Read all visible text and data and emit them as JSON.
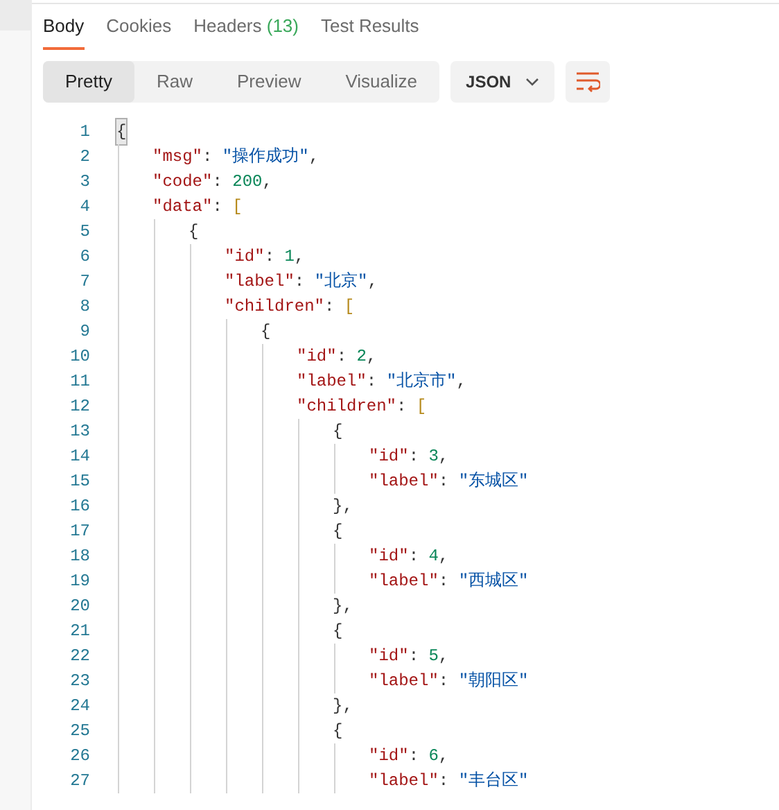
{
  "tabs": [
    {
      "label": "Body",
      "selected": true
    },
    {
      "label": "Cookies",
      "selected": false
    },
    {
      "label": "Headers",
      "count": "(13)",
      "selected": false
    },
    {
      "label": "Test Results",
      "selected": false
    }
  ],
  "view_modes": [
    {
      "label": "Pretty",
      "selected": true
    },
    {
      "label": "Raw",
      "selected": false
    },
    {
      "label": "Preview",
      "selected": false
    },
    {
      "label": "Visualize",
      "selected": false
    }
  ],
  "format_dropdown": {
    "value": "JSON"
  },
  "code": [
    {
      "number": "1",
      "tokens": [
        {
          "kind": "matched-brace",
          "text": "{"
        }
      ],
      "children": [
        {
          "number": "2",
          "tokens": [
            {
              "kind": "key",
              "text": "\"msg\""
            },
            {
              "kind": "punct",
              "text": ": "
            },
            {
              "kind": "string",
              "text": "\"操作成功\""
            },
            {
              "kind": "punct",
              "text": ","
            }
          ]
        },
        {
          "number": "3",
          "tokens": [
            {
              "kind": "key",
              "text": "\"code\""
            },
            {
              "kind": "punct",
              "text": ": "
            },
            {
              "kind": "number",
              "text": "200"
            },
            {
              "kind": "punct",
              "text": ","
            }
          ]
        },
        {
          "number": "4",
          "tokens": [
            {
              "kind": "key",
              "text": "\"data\""
            },
            {
              "kind": "punct",
              "text": ": "
            },
            {
              "kind": "bracket",
              "text": "["
            }
          ],
          "children": [
            {
              "number": "5",
              "tokens": [
                {
                  "kind": "punct",
                  "text": "{"
                }
              ],
              "children": [
                {
                  "number": "6",
                  "tokens": [
                    {
                      "kind": "key",
                      "text": "\"id\""
                    },
                    {
                      "kind": "punct",
                      "text": ": "
                    },
                    {
                      "kind": "number",
                      "text": "1"
                    },
                    {
                      "kind": "punct",
                      "text": ","
                    }
                  ]
                },
                {
                  "number": "7",
                  "tokens": [
                    {
                      "kind": "key",
                      "text": "\"label\""
                    },
                    {
                      "kind": "punct",
                      "text": ": "
                    },
                    {
                      "kind": "string",
                      "text": "\"北京\""
                    },
                    {
                      "kind": "punct",
                      "text": ","
                    }
                  ]
                },
                {
                  "number": "8",
                  "tokens": [
                    {
                      "kind": "key",
                      "text": "\"children\""
                    },
                    {
                      "kind": "punct",
                      "text": ": "
                    },
                    {
                      "kind": "bracket",
                      "text": "["
                    }
                  ],
                  "children": [
                    {
                      "number": "9",
                      "tokens": [
                        {
                          "kind": "punct",
                          "text": "{"
                        }
                      ],
                      "children": [
                        {
                          "number": "10",
                          "tokens": [
                            {
                              "kind": "key",
                              "text": "\"id\""
                            },
                            {
                              "kind": "punct",
                              "text": ": "
                            },
                            {
                              "kind": "number",
                              "text": "2"
                            },
                            {
                              "kind": "punct",
                              "text": ","
                            }
                          ]
                        },
                        {
                          "number": "11",
                          "tokens": [
                            {
                              "kind": "key",
                              "text": "\"label\""
                            },
                            {
                              "kind": "punct",
                              "text": ": "
                            },
                            {
                              "kind": "string",
                              "text": "\"北京市\""
                            },
                            {
                              "kind": "punct",
                              "text": ","
                            }
                          ]
                        },
                        {
                          "number": "12",
                          "tokens": [
                            {
                              "kind": "key",
                              "text": "\"children\""
                            },
                            {
                              "kind": "punct",
                              "text": ": "
                            },
                            {
                              "kind": "bracket",
                              "text": "["
                            }
                          ],
                          "children": [
                            {
                              "number": "13",
                              "tokens": [
                                {
                                  "kind": "punct",
                                  "text": "{"
                                }
                              ],
                              "children": [
                                {
                                  "number": "14",
                                  "tokens": [
                                    {
                                      "kind": "key",
                                      "text": "\"id\""
                                    },
                                    {
                                      "kind": "punct",
                                      "text": ": "
                                    },
                                    {
                                      "kind": "number",
                                      "text": "3"
                                    },
                                    {
                                      "kind": "punct",
                                      "text": ","
                                    }
                                  ]
                                },
                                {
                                  "number": "15",
                                  "tokens": [
                                    {
                                      "kind": "key",
                                      "text": "\"label\""
                                    },
                                    {
                                      "kind": "punct",
                                      "text": ": "
                                    },
                                    {
                                      "kind": "string",
                                      "text": "\"东城区\""
                                    }
                                  ]
                                }
                              ]
                            },
                            {
                              "number": "16",
                              "tokens": [
                                {
                                  "kind": "punct",
                                  "text": "},"
                                }
                              ]
                            },
                            {
                              "number": "17",
                              "tokens": [
                                {
                                  "kind": "punct",
                                  "text": "{"
                                }
                              ],
                              "children": [
                                {
                                  "number": "18",
                                  "tokens": [
                                    {
                                      "kind": "key",
                                      "text": "\"id\""
                                    },
                                    {
                                      "kind": "punct",
                                      "text": ": "
                                    },
                                    {
                                      "kind": "number",
                                      "text": "4"
                                    },
                                    {
                                      "kind": "punct",
                                      "text": ","
                                    }
                                  ]
                                },
                                {
                                  "number": "19",
                                  "tokens": [
                                    {
                                      "kind": "key",
                                      "text": "\"label\""
                                    },
                                    {
                                      "kind": "punct",
                                      "text": ": "
                                    },
                                    {
                                      "kind": "string",
                                      "text": "\"西城区\""
                                    }
                                  ]
                                }
                              ]
                            },
                            {
                              "number": "20",
                              "tokens": [
                                {
                                  "kind": "punct",
                                  "text": "},"
                                }
                              ]
                            },
                            {
                              "number": "21",
                              "tokens": [
                                {
                                  "kind": "punct",
                                  "text": "{"
                                }
                              ],
                              "children": [
                                {
                                  "number": "22",
                                  "tokens": [
                                    {
                                      "kind": "key",
                                      "text": "\"id\""
                                    },
                                    {
                                      "kind": "punct",
                                      "text": ": "
                                    },
                                    {
                                      "kind": "number",
                                      "text": "5"
                                    },
                                    {
                                      "kind": "punct",
                                      "text": ","
                                    }
                                  ]
                                },
                                {
                                  "number": "23",
                                  "tokens": [
                                    {
                                      "kind": "key",
                                      "text": "\"label\""
                                    },
                                    {
                                      "kind": "punct",
                                      "text": ": "
                                    },
                                    {
                                      "kind": "string",
                                      "text": "\"朝阳区\""
                                    }
                                  ]
                                }
                              ]
                            },
                            {
                              "number": "24",
                              "tokens": [
                                {
                                  "kind": "punct",
                                  "text": "},"
                                }
                              ]
                            },
                            {
                              "number": "25",
                              "tokens": [
                                {
                                  "kind": "punct",
                                  "text": "{"
                                }
                              ],
                              "children": [
                                {
                                  "number": "26",
                                  "tokens": [
                                    {
                                      "kind": "key",
                                      "text": "\"id\""
                                    },
                                    {
                                      "kind": "punct",
                                      "text": ": "
                                    },
                                    {
                                      "kind": "number",
                                      "text": "6"
                                    },
                                    {
                                      "kind": "punct",
                                      "text": ","
                                    }
                                  ]
                                },
                                {
                                  "number": "27",
                                  "tokens": [
                                    {
                                      "kind": "key",
                                      "text": "\"label\""
                                    },
                                    {
                                      "kind": "punct",
                                      "text": ": "
                                    },
                                    {
                                      "kind": "string",
                                      "text": "\"丰台区\""
                                    }
                                  ]
                                }
                              ]
                            }
                          ]
                        }
                      ]
                    }
                  ]
                }
              ]
            }
          ]
        }
      ]
    }
  ]
}
